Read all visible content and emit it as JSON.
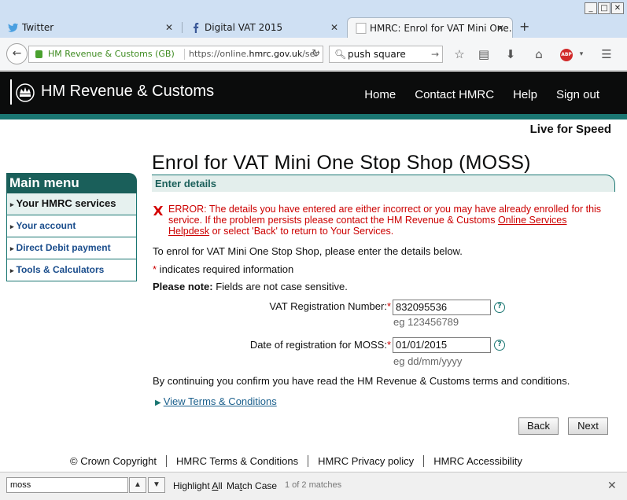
{
  "window": {
    "min": "_",
    "max": "□",
    "close": "✕"
  },
  "tabs": [
    {
      "label": "Twitter",
      "icon": "twitter-icon"
    },
    {
      "label": "Digital VAT 2015",
      "icon": "facebook-icon"
    },
    {
      "label": "HMRC: Enrol for VAT Mini One...",
      "icon": "page-icon"
    }
  ],
  "nav": {
    "site_identity": "HM Revenue & Customs (GB)",
    "url_prefix": "https://online.",
    "url_domain": "hmrc.gov.uk",
    "url_rest": "/service",
    "search_value": "push square"
  },
  "site": {
    "brand": "HM Revenue & Customs",
    "topnav": [
      "Home",
      "Contact HMRC",
      "Help",
      "Sign out"
    ],
    "tagline": "Live for Speed"
  },
  "menu": {
    "title": "Main menu",
    "items": [
      "Your HMRC services",
      "Your account",
      "Direct Debit payment",
      "Tools & Calculators"
    ]
  },
  "content": {
    "title": "Enrol for VAT Mini One Stop Shop (MOSS)",
    "panel_heading": "Enter details",
    "error_pre": "ERROR: The details you have entered are either incorrect or you may have already enrolled for this service. If the problem persists please contact the HM Revenue & Customs ",
    "error_link": "Online Services Helpdesk",
    "error_post": " or select 'Back' to return to Your Services.",
    "intro": "To enrol for VAT Mini One Stop Shop, please enter the details below.",
    "required_marker": "*",
    "required_note": " indicates required information",
    "note_bold": "Please note:",
    "note_text": " Fields are not case sensitive.",
    "fields": [
      {
        "label": "VAT Registration Number:",
        "value": "832095536",
        "hint": "eg 123456789"
      },
      {
        "label": "Date of registration for MOSS:",
        "value": "01/01/2015",
        "hint": "eg dd/mm/yyyy"
      }
    ],
    "help_glyph": "?",
    "confirm": "By continuing you confirm you have read the HM Revenue & Customs terms and conditions.",
    "terms_link": "View Terms & Conditions",
    "back_label": "Back",
    "next_label": "Next"
  },
  "footer": [
    "© Crown Copyright",
    "HMRC Terms & Conditions",
    "HMRC Privacy policy",
    "HMRC Accessibility"
  ],
  "findbar": {
    "value": "moss",
    "highlight_pre": "Highlight ",
    "highlight_u": "A",
    "highlight_post": "ll",
    "match_pre": "Ma",
    "match_u": "t",
    "match_post": "ch Case",
    "status": "1 of 2 matches"
  }
}
